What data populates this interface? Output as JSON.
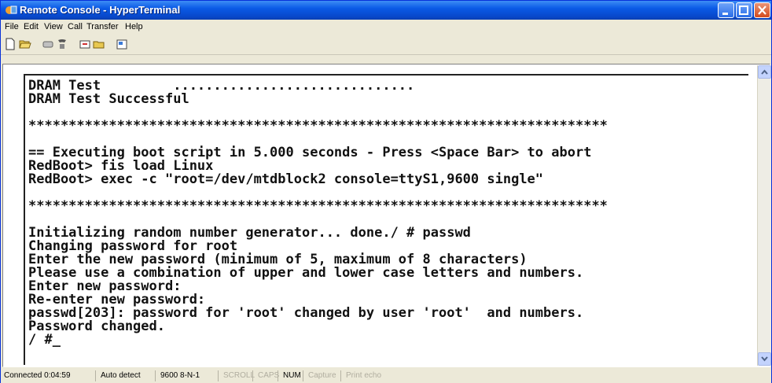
{
  "window": {
    "title": "Remote Console - HyperTerminal"
  },
  "menu": [
    "File",
    "Edit",
    "View",
    "Call",
    "Transfer",
    "Help"
  ],
  "toolbar": [
    "new-document-icon",
    "open-folder-icon",
    "disconnect-icon",
    "phone-icon",
    "send-icon",
    "receive-icon",
    "properties-icon"
  ],
  "terminal": {
    "lines": [
      "DRAM Test         ..............................",
      "DRAM Test Successful",
      "",
      "************************************************************************",
      "",
      "== Executing boot script in 5.000 seconds - Press <Space Bar> to abort",
      "RedBoot> fis load Linux",
      "RedBoot> exec -c \"root=/dev/mtdblock2 console=ttyS1,9600 single\"",
      "",
      "************************************************************************",
      "",
      "Initializing random number generator... done./ # passwd",
      "Changing password for root",
      "Enter the new password (minimum of 5, maximum of 8 characters)",
      "Please use a combination of upper and lower case letters and numbers.",
      "Enter new password:",
      "Re-enter new password:",
      "passwd[203]: password for 'root' changed by user 'root'  and numbers.",
      "Password changed.",
      "/ #_"
    ]
  },
  "status": {
    "connected": "Connected 0:04:59",
    "detect": "Auto detect",
    "settings": "9600 8-N-1",
    "scroll": "SCROLL",
    "caps": "CAPS",
    "num": "NUM",
    "capture": "Capture",
    "print_echo": "Print echo"
  }
}
